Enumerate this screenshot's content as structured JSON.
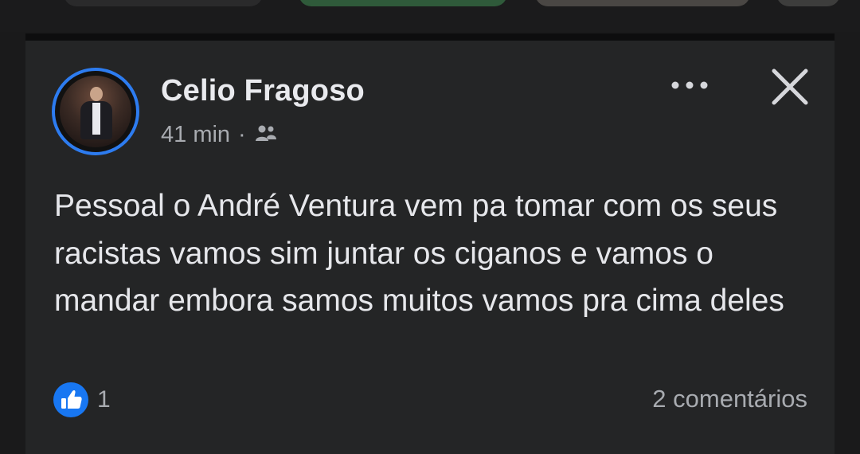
{
  "post": {
    "author": "Celio Fragoso",
    "time": "41 min",
    "separator": "·",
    "audience_icon": "group-icon",
    "text": "Pessoal o André Ventura vem pa tomar com os seus racistas vamos sim juntar os ciganos e vamos o mandar embora samos muitos vamos pra cima deles",
    "reactions": {
      "icon": "like-icon",
      "count": "1"
    },
    "comments": "2 comentários"
  },
  "colors": {
    "background": "#1a1a1b",
    "card": "#242526",
    "avatar_ring": "#2d7cf0",
    "like_blue": "#1877f2",
    "secondary_text": "#a8abb0"
  }
}
